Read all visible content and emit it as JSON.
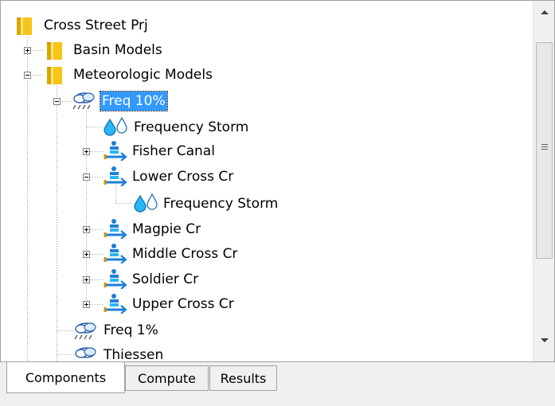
{
  "tree": {
    "root": "Cross Street Prj",
    "basin_models": "Basin Models",
    "meteorologic_models": "Meteorologic Models",
    "freq10": "Freq 10%",
    "freq10_storm": "Frequency Storm",
    "fisher_canal": "Fisher Canal",
    "lower_cross": "Lower Cross Cr",
    "lower_cross_storm": "Frequency Storm",
    "magpie": "Magpie Cr",
    "middle_cross": "Middle Cross Cr",
    "soldier": "Soldier Cr",
    "upper_cross": "Upper Cross Cr",
    "freq1": "Freq 1%",
    "thiessen": "Thiessen"
  },
  "tabs": {
    "components": "Components",
    "compute": "Compute",
    "results": "Results",
    "active": "Components"
  },
  "colors": {
    "selection": "#3399ff",
    "folder": "#e8b400",
    "water": "#1e7fd8"
  },
  "icons": [
    "folder-icon",
    "meteorologic-model-icon",
    "precipitation-icon",
    "subbasin-icon",
    "expand-icon",
    "collapse-icon",
    "scroll-up-icon",
    "scroll-down-icon"
  ]
}
